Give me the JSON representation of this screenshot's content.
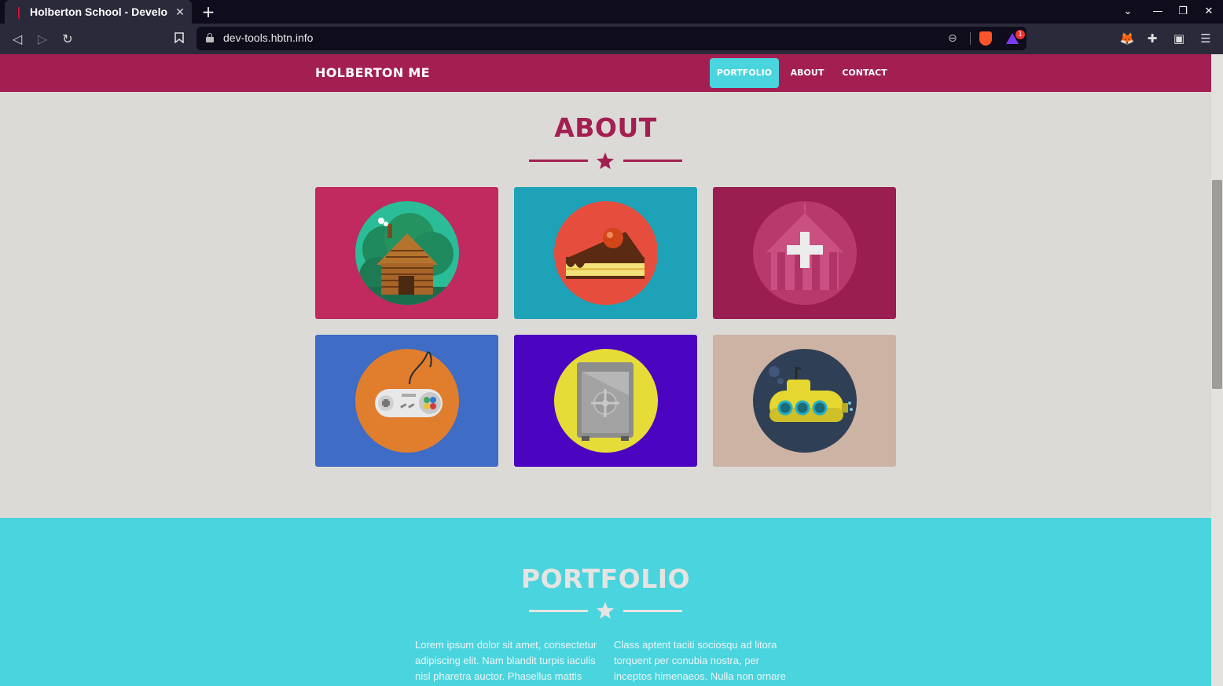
{
  "browser": {
    "tab_title": "Holberton School - Develo",
    "tab_close": "✕",
    "new_tab": "+",
    "url": "dev-tools.hbtn.info",
    "rewards_badge": "1",
    "window_controls": [
      "⌄",
      "—",
      "❐",
      "✕"
    ]
  },
  "site": {
    "brand": "HOLBERTON ME",
    "nav": [
      {
        "label": "PORTFOLIO",
        "active": true
      },
      {
        "label": "ABOUT",
        "active": false
      },
      {
        "label": "CONTACT",
        "active": false
      }
    ]
  },
  "about": {
    "title": "ABOUT",
    "tiles": [
      {
        "name": "cabin",
        "bg": "#c02a5f",
        "circle": "#2bbd98"
      },
      {
        "name": "cake",
        "bg": "#1ea2b7",
        "circle": "#e64d3d"
      },
      {
        "name": "circus-tent",
        "bg": "#9a1e4f",
        "circle": "#b83a6c"
      },
      {
        "name": "game-controller",
        "bg": "#3f6cc4",
        "circle": "#e07e2e"
      },
      {
        "name": "safe",
        "bg": "#4b04c0",
        "circle": "#e6dc38"
      },
      {
        "name": "submarine",
        "bg": "#cdb3a3",
        "circle": "#2f3f55"
      }
    ]
  },
  "portfolio": {
    "title": "PORTFOLIO",
    "col1": "Lorem ipsum dolor sit amet, consectetur adipiscing elit. Nam blandit turpis iaculis nisl pharetra auctor. Phasellus mattis",
    "col2": "Class aptent taciti sociosqu ad litora torquent per conubia nostra, per inceptos himenaeos. Nulla non ornare"
  },
  "colors": {
    "primary": "#a31f52",
    "accent": "#4ad4dd",
    "background": "#dcdad7"
  }
}
